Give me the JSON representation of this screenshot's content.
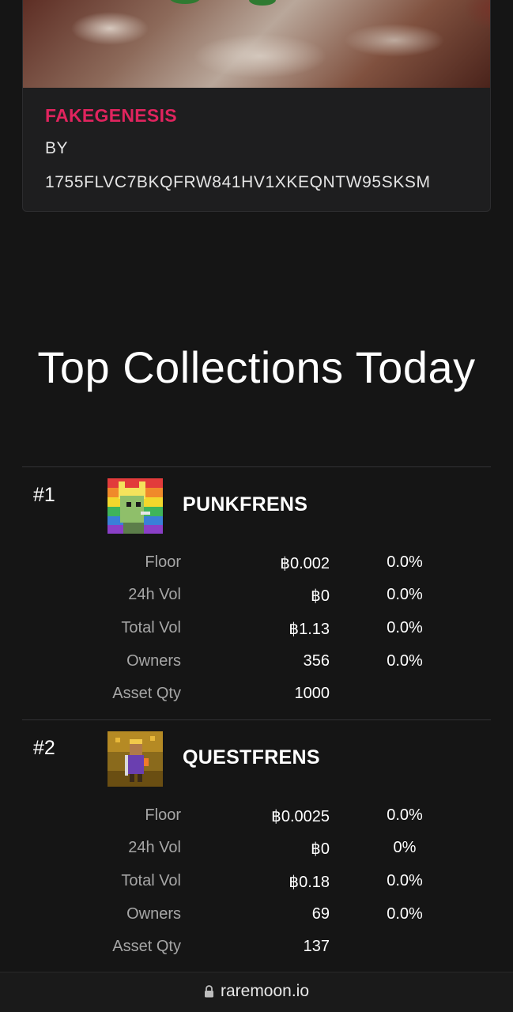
{
  "featured": {
    "collection_name": "FAKEGENESIS",
    "by_label": "BY",
    "owner_address": "1755FLVC7BKQFRW841HV1XKEQNTW95SKSM"
  },
  "section_title": "Top Collections Today",
  "collections": [
    {
      "rank": "#1",
      "name": "PUNKFRENS",
      "stats": [
        {
          "label": "Floor",
          "value": "฿0.002",
          "change": "0.0%"
        },
        {
          "label": "24h Vol",
          "value": "฿0",
          "change": "0.0%"
        },
        {
          "label": "Total Vol",
          "value": "฿1.13",
          "change": "0.0%"
        },
        {
          "label": "Owners",
          "value": "356",
          "change": "0.0%"
        },
        {
          "label": "Asset Qty",
          "value": "1000",
          "change": ""
        }
      ]
    },
    {
      "rank": "#2",
      "name": "QUESTFRENS",
      "stats": [
        {
          "label": "Floor",
          "value": "฿0.0025",
          "change": "0.0%"
        },
        {
          "label": "24h Vol",
          "value": "฿0",
          "change": "0%"
        },
        {
          "label": "Total Vol",
          "value": "฿0.18",
          "change": "0.0%"
        },
        {
          "label": "Owners",
          "value": "69",
          "change": "0.0%"
        },
        {
          "label": "Asset Qty",
          "value": "137",
          "change": ""
        }
      ]
    }
  ],
  "footer": {
    "domain": "raremoon.io",
    "icon": "lock-icon"
  },
  "colors": {
    "accent": "#e0245e",
    "background": "#151515",
    "card": "#1e1e1f",
    "muted_text": "#a6a6a6"
  }
}
